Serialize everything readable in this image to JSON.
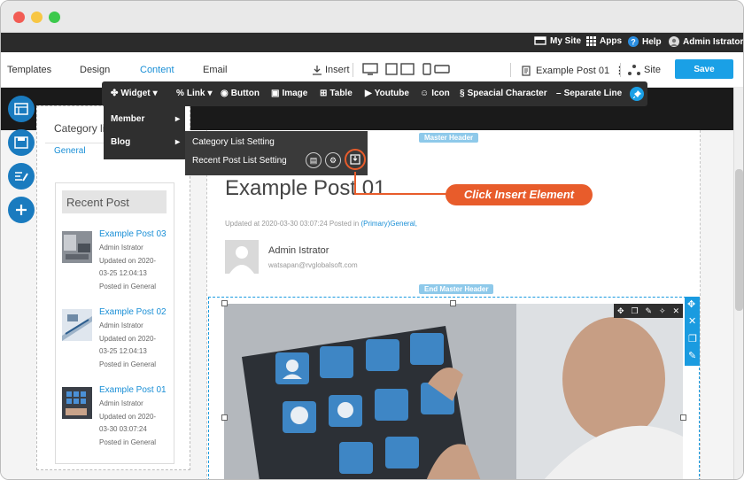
{
  "window": {
    "traffic_lights": [
      "#f25c54",
      "#f7c644",
      "#3cc94c"
    ]
  },
  "topbar": {
    "my_site": "My Site",
    "apps": "Apps",
    "help": "Help",
    "user": "Admin Istrator"
  },
  "menubar": {
    "templates": "Templates",
    "design": "Design",
    "content": "Content",
    "email": "Email",
    "insert": "Insert",
    "page_name": "Example Post 01",
    "site": "Site",
    "save": "Save"
  },
  "toolbar": {
    "widget": "Widget",
    "link": "Link",
    "button": "Button",
    "image": "Image",
    "table": "Table",
    "youtube": "Youtube",
    "icon": "Icon",
    "special": "Speacial Character",
    "separate": "Separate Line"
  },
  "dropdown": {
    "member": "Member",
    "blog": "Blog"
  },
  "submenu": {
    "category": "Category List Setting",
    "recent": "Recent Post List Setting"
  },
  "callout": {
    "text": "Click Insert Element"
  },
  "left": {
    "category_tab": "Category li",
    "general": "General",
    "recent_title": "Recent Post",
    "posts": [
      {
        "title": "Example Post 03",
        "author": "Admin Istrator",
        "updated1": "Updated on 2020-",
        "updated2": "03-25 12:04:13",
        "posted": "Posted in General"
      },
      {
        "title": "Example Post 02",
        "author": "Admin Istrator",
        "updated1": "Updated on 2020-",
        "updated2": "03-25 12:04:13",
        "posted": "Posted in General"
      },
      {
        "title": "Example Post 01",
        "author": "Admin Istrator",
        "updated1": "Updated on 2020-",
        "updated2": "03-30 03:07:24",
        "posted": "Posted in General"
      }
    ]
  },
  "main": {
    "master_header": "Master Header",
    "end_master_header": "End Master Header",
    "title": "Example Post 01",
    "updated": "Updated at 2020-03-30 03:07:24 Posted in ",
    "category": "(Primary)General,",
    "author": "Admin Istrator",
    "email": "watsapan@rvglobalsoft.com"
  },
  "colors": {
    "accent": "#1aa0e6",
    "callout": "#e85c2b",
    "dark": "#2f2f2f"
  }
}
